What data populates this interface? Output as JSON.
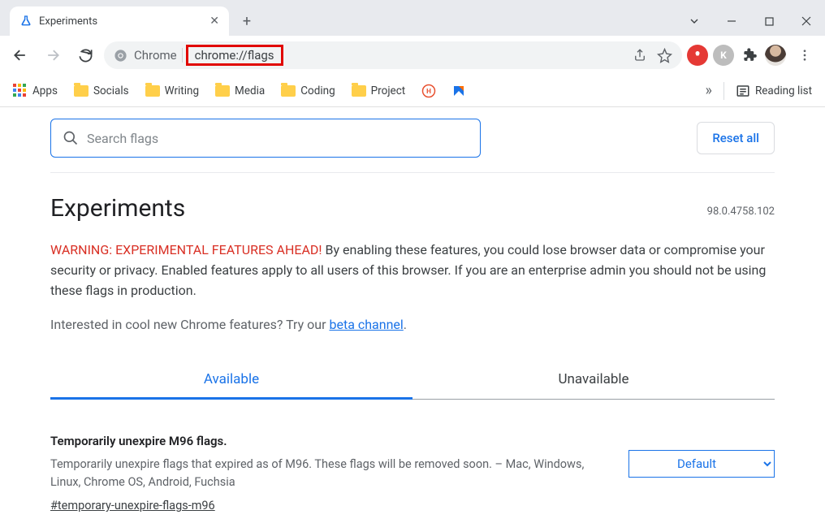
{
  "tab": {
    "title": "Experiments"
  },
  "omnibox": {
    "chip": "Chrome",
    "url": "chrome://flags"
  },
  "bookmarks": {
    "apps": "Apps",
    "items": [
      "Socials",
      "Writing",
      "Media",
      "Coding",
      "Project"
    ],
    "reading_list": "Reading list"
  },
  "search": {
    "placeholder": "Search flags"
  },
  "reset_label": "Reset all",
  "heading": "Experiments",
  "version": "98.0.4758.102",
  "warning": {
    "red": "WARNING: EXPERIMENTAL FEATURES AHEAD!",
    "rest": " By enabling these features, you could lose browser data or compromise your security or privacy. Enabled features apply to all users of this browser. If you are an enterprise admin you should not be using these flags in production."
  },
  "beta": {
    "lead": "Interested in cool new Chrome features? Try our ",
    "link": "beta channel",
    "tail": "."
  },
  "tabs": {
    "available": "Available",
    "unavailable": "Unavailable"
  },
  "flag": {
    "name": "Temporarily unexpire M96 flags.",
    "desc": "Temporarily unexpire flags that expired as of M96. These flags will be removed soon. – Mac, Windows, Linux, Chrome OS, Android, Fuchsia",
    "anchor": "#temporary-unexpire-flags-m96",
    "selected": "Default"
  }
}
